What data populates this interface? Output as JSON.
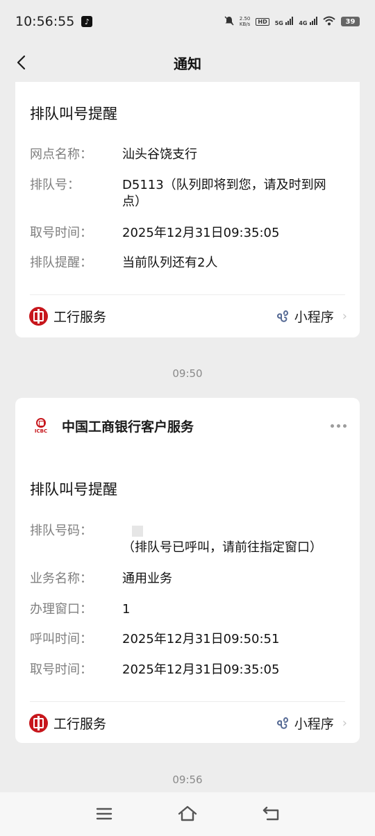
{
  "status_bar": {
    "time": "10:56:55",
    "net_speed_value": "2.50",
    "net_speed_unit": "KB/s",
    "hd_label": "HD",
    "net_5g": "5G",
    "net_4g": "4G",
    "battery": "39",
    "app_icon": "tiktok-icon"
  },
  "nav": {
    "title": "通知"
  },
  "card1": {
    "title": "排队叫号提醒",
    "rows": [
      {
        "label": "网点名称：",
        "value": "汕头谷饶支行"
      },
      {
        "label": "排队号：",
        "value": "D5113（队列即将到您，请及时到网点）"
      },
      {
        "label": "取号时间：",
        "value": "2025年12月31日09:35:05"
      },
      {
        "label": "排队提醒：",
        "value": "当前队列还有2人"
      }
    ],
    "footer": {
      "service": "工行服务",
      "mini_program": "小程序"
    }
  },
  "timestamp1": "09:50",
  "card2": {
    "sender": "中国工商银行客户服务",
    "sender_logo_text": "ICBC",
    "title": "排队叫号提醒",
    "rows": [
      {
        "label": "排队号码：",
        "value": "（排队号已呼叫，请前往指定窗口）"
      },
      {
        "label": "业务名称：",
        "value": "通用业务"
      },
      {
        "label": "办理窗口：",
        "value": "1"
      },
      {
        "label": "呼叫时间：",
        "value": "2025年12月31日09:50:51"
      },
      {
        "label": "取号时间：",
        "value": "2025年12月31日09:35:05"
      }
    ],
    "footer": {
      "service": "工行服务",
      "mini_program": "小程序"
    }
  },
  "timestamp2": "09:56",
  "colors": {
    "icbc_red": "#c7161c",
    "background": "#ededed",
    "label_gray": "#7f7f7f",
    "mini_program_blue": "#576b95"
  }
}
